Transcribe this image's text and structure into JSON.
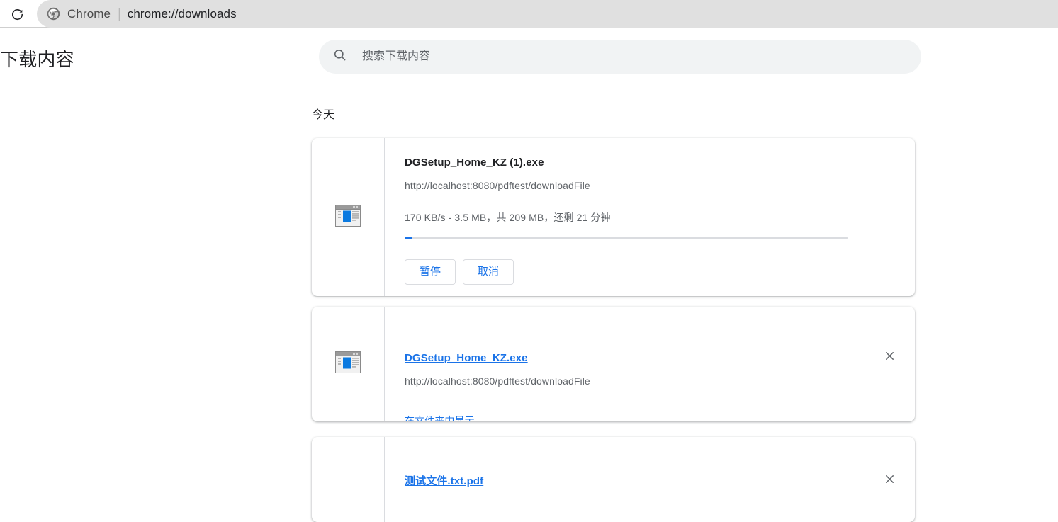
{
  "browser": {
    "reload_icon": "reload-icon",
    "chrome_logo_icon": "chrome-logo-icon",
    "app_label": "Chrome",
    "separator": "|",
    "url": "chrome://downloads"
  },
  "page": {
    "title": "下载内容",
    "search": {
      "icon": "search-icon",
      "placeholder": "搜索下载内容",
      "value": ""
    },
    "date_header": "今天"
  },
  "downloads": [
    {
      "file_icon": "application-window-icon",
      "name": "DGSetup_Home_KZ (1).exe",
      "is_link": false,
      "url": "http://localhost:8080/pdftest/downloadFile",
      "status": "170 KB/s - 3.5 MB，共 209 MB，还剩 21 分钟",
      "progress_percent": 1.7,
      "progress_color": "#1a73e8",
      "buttons": [
        {
          "label": "暂停",
          "name": "pause-button"
        },
        {
          "label": "取消",
          "name": "cancel-button"
        }
      ],
      "has_close": false
    },
    {
      "file_icon": "application-window-icon",
      "name": "DGSetup_Home_KZ.exe",
      "is_link": true,
      "url": "http://localhost:8080/pdftest/downloadFile",
      "show_in_folder_label": "在文件夹中显示",
      "close_icon": "close-icon",
      "has_close": true
    },
    {
      "file_icon": "document-icon",
      "name": "测试文件.txt.pdf",
      "is_link": true,
      "close_icon": "close-icon",
      "has_close": true
    }
  ],
  "colors": {
    "link_blue": "#1a73e8",
    "text_primary": "#202124",
    "text_secondary": "#5f6368",
    "omnibox_bg": "#e0e0e0",
    "search_bg": "#f1f3f4",
    "card_border": "#dadce0"
  }
}
